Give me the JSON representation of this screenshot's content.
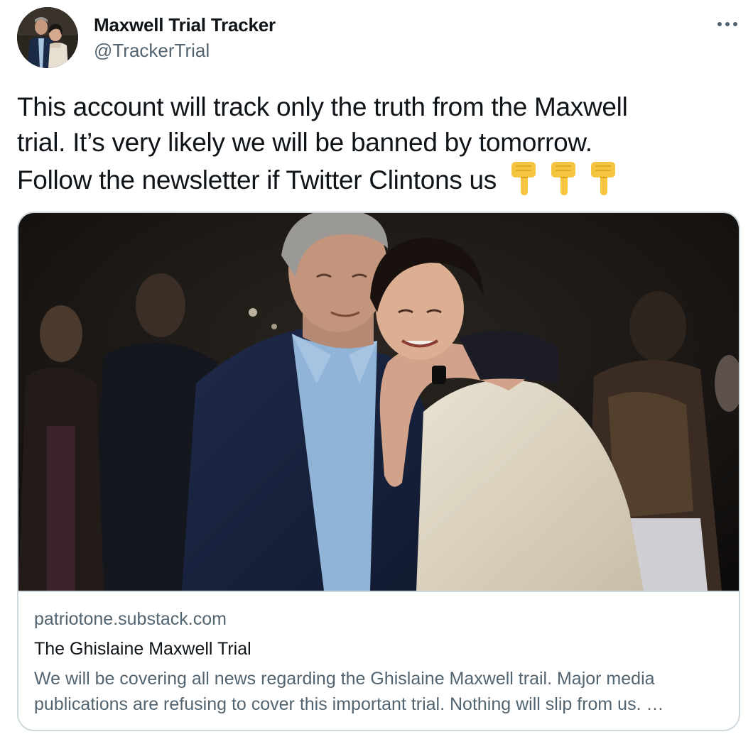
{
  "author": {
    "display_name": "Maxwell Trial Tracker",
    "handle": "@TrackerTrial",
    "avatar_icon": "profile-photo"
  },
  "more_icon": "more-horizontal-icon",
  "tweet": {
    "lines": [
      "This account will track only the truth from the Maxwell",
      "trial. It’s very likely we will be banned by tomorrow.",
      "Follow the newsletter if Twitter Clintons us"
    ],
    "emoji": [
      "👇",
      "👇",
      "👇"
    ]
  },
  "card": {
    "image_icon": "article-photo",
    "domain": "patriotone.substack.com",
    "title": "The Ghislaine Maxwell Trial",
    "description_lines": [
      "We will be covering all news regarding the Ghislaine Maxwell trail. Major media",
      "publications are refusing to cover this important trial. Nothing will slip from us. …"
    ]
  },
  "colors": {
    "text_primary": "#0f1419",
    "text_secondary": "#536471",
    "border": "#cfd9de",
    "emoji": "#f5c542"
  }
}
